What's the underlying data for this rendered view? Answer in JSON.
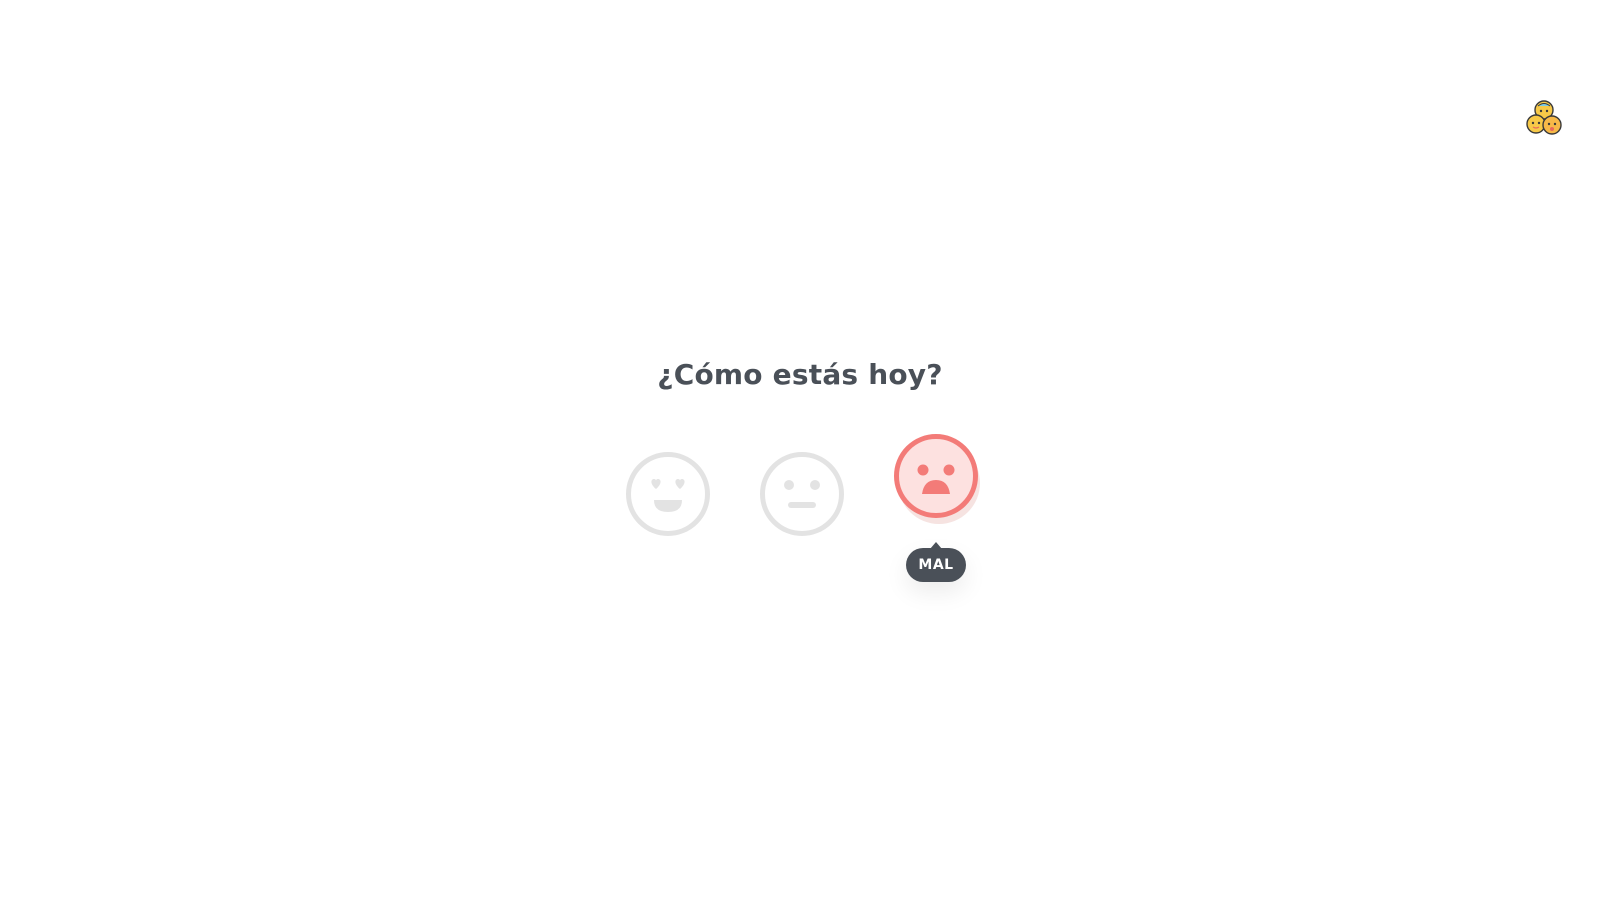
{
  "title": "¿Cómo estás hoy?",
  "moods": [
    {
      "label": "love",
      "icon": "heart-eyes-face-icon",
      "selected": false,
      "color": "#e3e3e3"
    },
    {
      "label": "neutral",
      "icon": "neutral-face-icon",
      "selected": false,
      "color": "#e3e3e3"
    },
    {
      "label": "MAL",
      "icon": "sad-face-icon",
      "selected": true,
      "color": "#f37b78"
    }
  ],
  "tooltip": {
    "label": "MAL"
  },
  "logo": {
    "icon": "emoji-logo-icon"
  },
  "colors": {
    "text": "#4a5058",
    "inactive": "#e3e3e3",
    "accent": "#f37b78",
    "accent_fill": "#fde1e0",
    "tooltip_bg": "#4a5058"
  }
}
